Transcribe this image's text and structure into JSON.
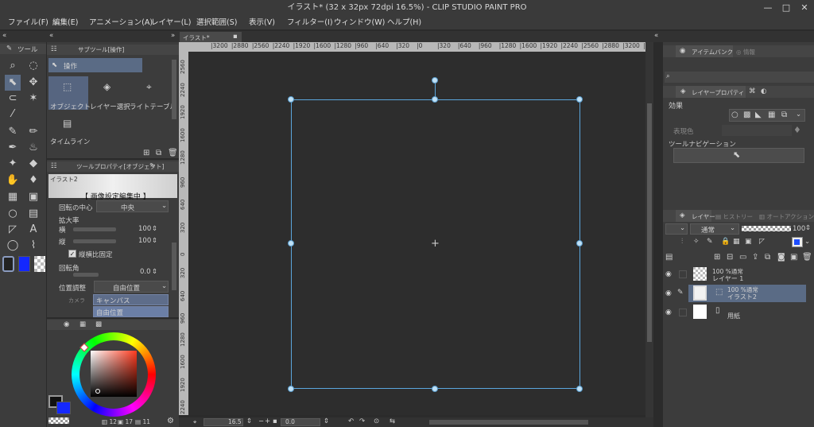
{
  "window": {
    "title": "イラスト* (32 x 32px 72dpi 16.5%)  - CLIP STUDIO PAINT PRO",
    "minimize": "—",
    "maximize": "□",
    "close": "✕"
  },
  "menu": {
    "items": [
      "ファイル(F)",
      "編集(E)",
      "アニメーション(A)",
      "レイヤー(L)",
      "選択範囲(S)",
      "表示(V)",
      "フィルター(I)",
      "ウィンドウ(W)",
      "ヘルプ(H)"
    ]
  },
  "toolbox": {
    "tab_label": "ツール"
  },
  "subtool": {
    "tab_label": "サブツール[操作]",
    "group_label": "操作",
    "items": [
      "オブジェクト",
      "レイヤー選択",
      "ライトテーブル",
      "タイムライン"
    ]
  },
  "tool_property": {
    "tab_label": "ツールプロパティ[オブジェクト]",
    "preview_name": "イラスト2",
    "editing_label": "【 画像設定編集中 】",
    "rotation_center_label": "回転の中心",
    "rotation_center_value": "中央",
    "scale_label": "拡大率",
    "width_label": "横",
    "width_value": "100",
    "height_label": "縦",
    "height_value": "100",
    "keep_ratio_label": "縦横比固定",
    "rotation_label": "回転角",
    "rotation_value": "0.0",
    "position_label": "位置調整",
    "position_value": "自由位置",
    "dropdown_options": [
      "キャンバス",
      "自由位置"
    ],
    "hidden_label": "カメラ"
  },
  "color": {
    "main_color": "#ffffff",
    "sub_color": "#1428ff",
    "footer_values": [
      "12",
      "17",
      "11"
    ]
  },
  "canvas": {
    "tab_label": "イラスト*",
    "ruler_top": [
      "3200",
      "2880",
      "2560",
      "2240",
      "1920",
      "1600",
      "1280",
      "960",
      "640",
      "320",
      "0",
      "320",
      "640",
      "960",
      "1280",
      "1600",
      "1920",
      "2240",
      "2560",
      "2880",
      "3200",
      "3520"
    ],
    "ruler_left": [
      "2560",
      "2240",
      "1920",
      "1600",
      "1280",
      "960",
      "640",
      "320",
      "0",
      "320",
      "640",
      "960",
      "1280",
      "1600",
      "1920",
      "2240"
    ],
    "zoom_value": "16.5",
    "angle_value": "0.0"
  },
  "item_bank": {
    "tab_label": "アイテムバンク",
    "tab2_label": "情報"
  },
  "layer_property": {
    "tab_label": "レイヤープロパティ",
    "effect_label": "効果",
    "expression_color_label": "表現色",
    "tool_nav_label": "ツールナビゲーション"
  },
  "layers": {
    "tab_label": "レイヤー",
    "tab2_label": "ヒストリー",
    "tab3_label": "オートアクション",
    "blend_mode": "通常",
    "opacity": "100",
    "rows": [
      {
        "meta": "100 %通常",
        "name": "レイヤー 1"
      },
      {
        "meta": "100 %通常",
        "name": "イラスト2"
      },
      {
        "meta": "",
        "name": "用紙"
      }
    ]
  }
}
